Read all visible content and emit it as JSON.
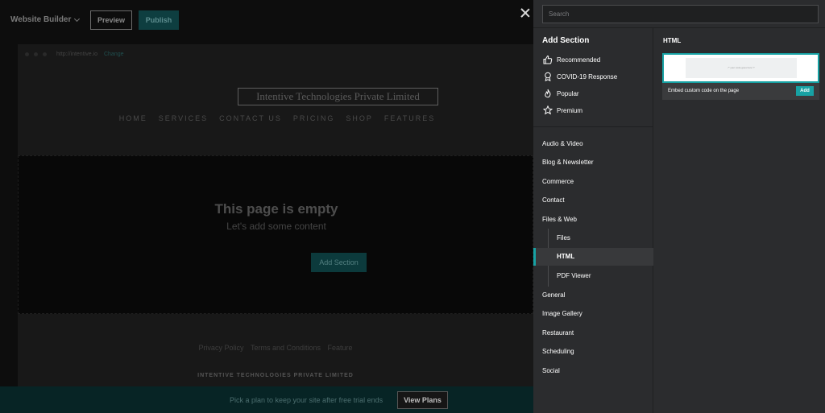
{
  "builder": {
    "brand": "Website Builder",
    "preview_label": "Preview",
    "publish_label": "Publish",
    "url": "http://intentive.io",
    "url_change": "Change",
    "site_logo": "Intentive Technologies Private Limited",
    "nav": [
      "HOME",
      "SERVICES",
      "CONTACT US",
      "PRICING",
      "SHOP",
      "FEATURES"
    ],
    "empty_title": "This page is empty",
    "empty_subtitle": "Let's add some content",
    "add_section_label": "Add Section",
    "footer_links": [
      "Privacy Policy",
      "Terms and Conditions",
      "Feature"
    ],
    "footer_company": "INTENTIVE TECHNOLOGIES PRIVATE LIMITED",
    "trial_text": "Pick a plan to keep your site after free trial ends",
    "view_plans_label": "View Plans"
  },
  "panel": {
    "search_placeholder": "Search",
    "title": "Add Section",
    "favorites": [
      {
        "label": "Recommended",
        "icon": "thumbs-up-icon"
      },
      {
        "label": "COVID-19 Response",
        "icon": "award-ribbon-icon"
      },
      {
        "label": "Popular",
        "icon": "flame-icon"
      },
      {
        "label": "Premium",
        "icon": "star-icon"
      }
    ],
    "categories": {
      "audio_video": "Audio & Video",
      "blog": "Blog & Newsletter",
      "commerce": "Commerce",
      "contact": "Contact",
      "files_web": "Files & Web",
      "files": "Files",
      "html": "HTML",
      "pdf": "PDF Viewer",
      "general": "General",
      "image_gallery": "Image Gallery",
      "restaurant": "Restaurant",
      "scheduling": "Scheduling",
      "social": "Social"
    },
    "preview_title": "HTML",
    "card_thumb_text": "/* your code goes here */",
    "card_description": "Embed custom code on the page",
    "card_add_label": "Add",
    "accent_color": "#17a2a4"
  }
}
